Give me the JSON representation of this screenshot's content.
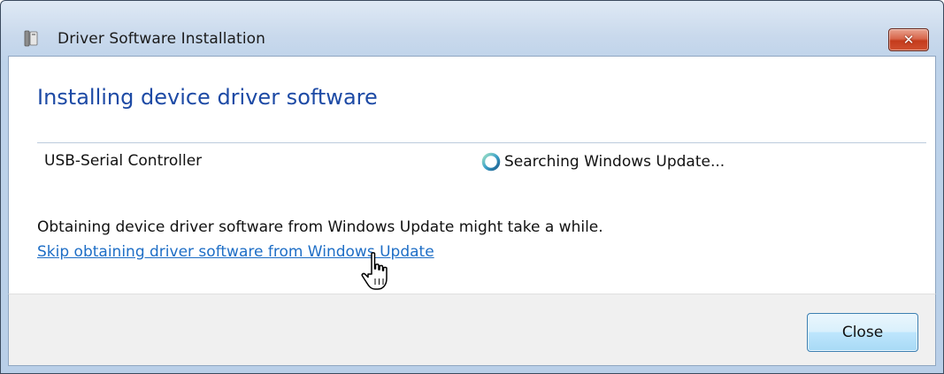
{
  "window": {
    "title": "Driver Software Installation",
    "close_glyph": "✕"
  },
  "main": {
    "heading": "Installing device driver software",
    "device": {
      "name": "USB-Serial Controller",
      "status": "Searching Windows Update..."
    },
    "info_text": "Obtaining device driver software from Windows Update might take a while.",
    "skip_link": "Skip obtaining driver software from Windows Update"
  },
  "footer": {
    "close_label": "Close"
  },
  "colors": {
    "heading": "#1d4aa5",
    "link": "#1e6ec6",
    "title_close": "#c43b1c",
    "button_accent": "#3c7fb1"
  },
  "icons": {
    "title": "device-installer-icon",
    "status": "progress-spinner-icon",
    "cursor": "hand-pointer-cursor"
  }
}
